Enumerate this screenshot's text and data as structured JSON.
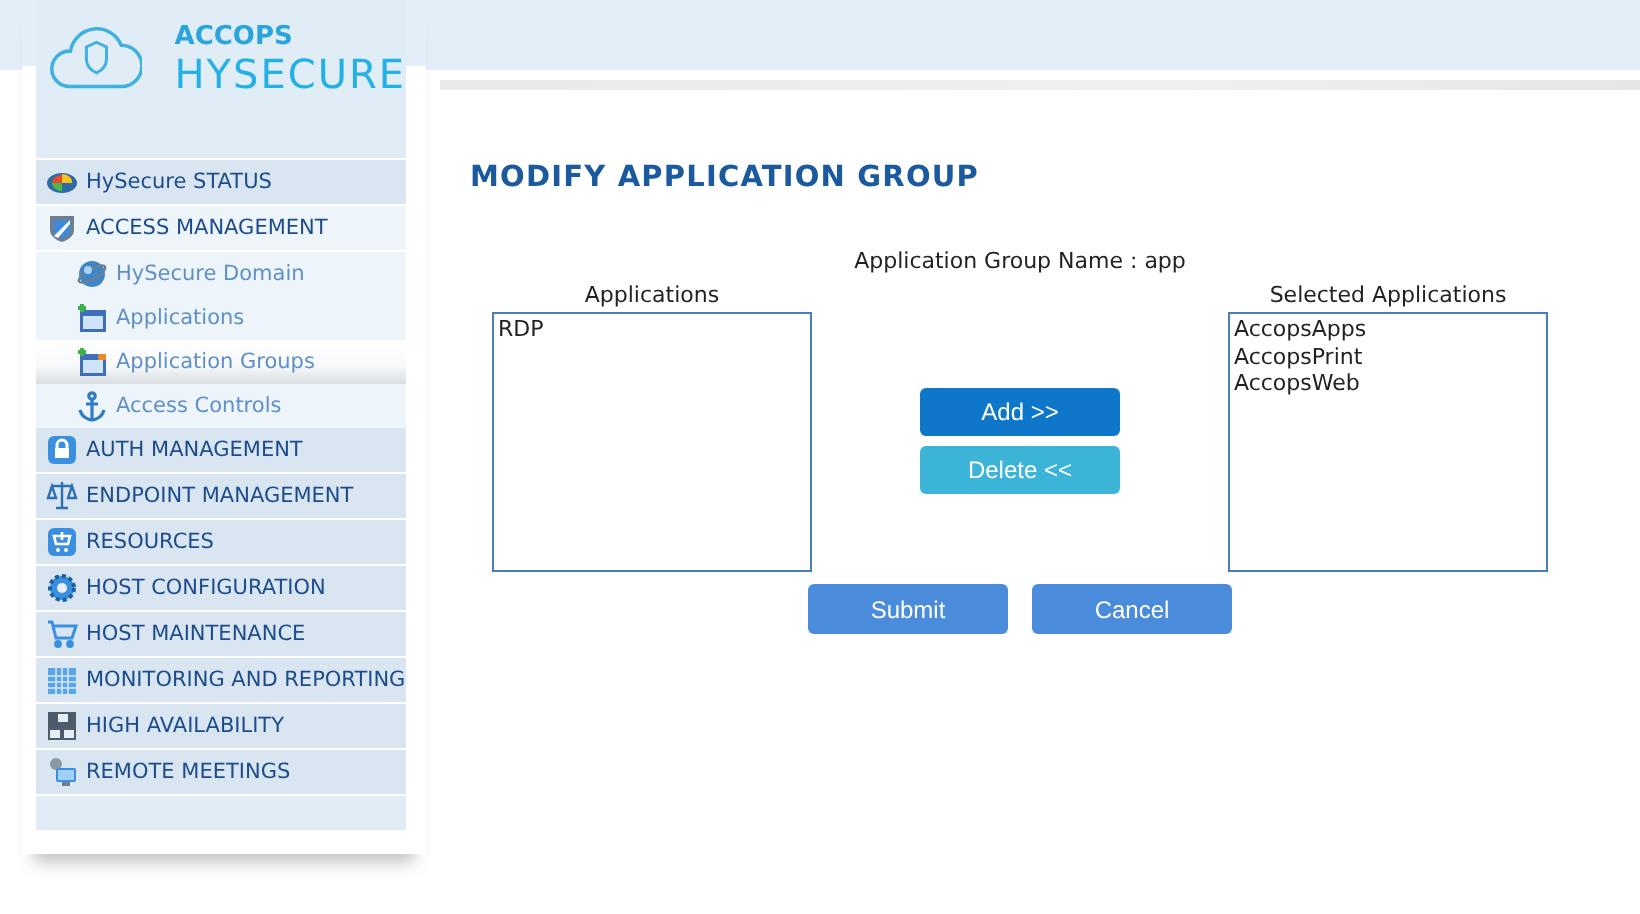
{
  "sidebar": {
    "logo": {
      "brand": "ACCOPS",
      "product": "HYSECURE"
    },
    "items": [
      {
        "label": "HySecure STATUS",
        "selected": false,
        "expanded": false
      },
      {
        "label": "ACCESS MANAGEMENT",
        "selected": false,
        "expanded": true,
        "children": [
          {
            "label": "HySecure Domain",
            "selected": false
          },
          {
            "label": "Applications",
            "selected": false
          },
          {
            "label": "Application Groups",
            "selected": true
          },
          {
            "label": "Access Controls",
            "selected": false
          }
        ]
      },
      {
        "label": "AUTH MANAGEMENT",
        "selected": false,
        "expanded": false
      },
      {
        "label": "ENDPOINT MANAGEMENT",
        "selected": false,
        "expanded": false
      },
      {
        "label": "RESOURCES",
        "selected": false,
        "expanded": false
      },
      {
        "label": "HOST CONFIGURATION",
        "selected": false,
        "expanded": false
      },
      {
        "label": "HOST MAINTENANCE",
        "selected": false,
        "expanded": false
      },
      {
        "label": "MONITORING AND REPORTING",
        "selected": false,
        "expanded": false
      },
      {
        "label": "HIGH AVAILABILITY",
        "selected": false,
        "expanded": false
      },
      {
        "label": "REMOTE MEETINGS",
        "selected": false,
        "expanded": false
      }
    ]
  },
  "main": {
    "title": "MODIFY APPLICATION GROUP",
    "group_name_label": "Application Group Name : app",
    "available": {
      "heading": "Applications",
      "items": [
        "RDP"
      ]
    },
    "chosen": {
      "heading": "Selected Applications",
      "items": [
        "AccopsApps",
        "AccopsPrint",
        "AccopsWeb"
      ]
    },
    "move_buttons": [
      {
        "label": "Add >>",
        "kind": "add"
      },
      {
        "label": "Delete <<",
        "kind": "delete"
      }
    ],
    "actions": [
      {
        "label": "Submit"
      },
      {
        "label": "Cancel"
      }
    ]
  }
}
